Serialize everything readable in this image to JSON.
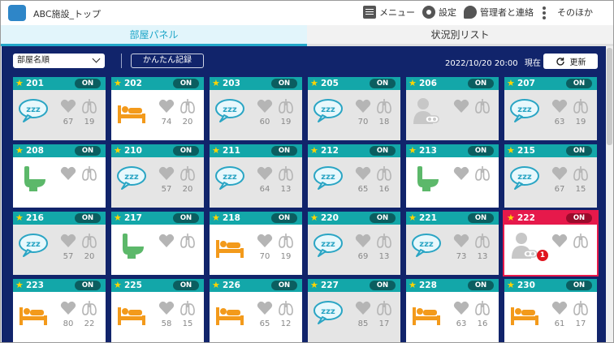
{
  "app": {
    "title": "ABC施設_トップ"
  },
  "header": {
    "menu_label": "メニュー",
    "settings_label": "設定",
    "contact_label": "管理者と連絡",
    "other_label": "そのほか"
  },
  "tabs": [
    {
      "label": "部屋パネル",
      "active": true
    },
    {
      "label": "状況別リスト",
      "active": false
    }
  ],
  "toolbar": {
    "sort_value": "部屋名順",
    "easy_record_label": "かんたん記録",
    "datetime": "2022/10/20 20:00",
    "current_label": "現在",
    "refresh_label": "更新"
  },
  "colors": {
    "board": "#11246b",
    "card_header": "#13a7a9",
    "alert": "#e6194b",
    "accent_orange": "#f39a1b",
    "accent_green": "#5cb86a",
    "accent_sleep": "#2aa5c4"
  },
  "rooms": [
    {
      "room": "201",
      "on": "ON",
      "status": "sleep",
      "hr": "67",
      "rr": "19"
    },
    {
      "room": "202",
      "on": "ON",
      "status": "bed",
      "hr": "74",
      "rr": "20"
    },
    {
      "room": "203",
      "on": "ON",
      "status": "sleep",
      "hr": "60",
      "rr": "19"
    },
    {
      "room": "205",
      "on": "ON",
      "status": "sleep",
      "hr": "70",
      "rr": "18"
    },
    {
      "room": "206",
      "on": "ON",
      "status": "away",
      "hr": "",
      "rr": ""
    },
    {
      "room": "207",
      "on": "ON",
      "status": "sleep",
      "hr": "63",
      "rr": "19"
    },
    {
      "room": "208",
      "on": "ON",
      "status": "toilet",
      "hr": "",
      "rr": ""
    },
    {
      "room": "210",
      "on": "ON",
      "status": "sleep",
      "hr": "57",
      "rr": "20"
    },
    {
      "room": "211",
      "on": "ON",
      "status": "sleep",
      "hr": "64",
      "rr": "13"
    },
    {
      "room": "212",
      "on": "ON",
      "status": "sleep",
      "hr": "65",
      "rr": "16"
    },
    {
      "room": "213",
      "on": "ON",
      "status": "toilet",
      "hr": "",
      "rr": ""
    },
    {
      "room": "215",
      "on": "ON",
      "status": "sleep",
      "hr": "67",
      "rr": "15"
    },
    {
      "room": "216",
      "on": "ON",
      "status": "sleep",
      "hr": "57",
      "rr": "20"
    },
    {
      "room": "217",
      "on": "ON",
      "status": "toilet",
      "hr": "",
      "rr": ""
    },
    {
      "room": "218",
      "on": "ON",
      "status": "bed",
      "hr": "70",
      "rr": "19"
    },
    {
      "room": "220",
      "on": "ON",
      "status": "sleep",
      "hr": "69",
      "rr": "13"
    },
    {
      "room": "221",
      "on": "ON",
      "status": "sleep",
      "hr": "73",
      "rr": "13"
    },
    {
      "room": "222",
      "on": "ON",
      "status": "away",
      "hr": "",
      "rr": "",
      "alert": true,
      "alert_count": "1"
    },
    {
      "room": "223",
      "on": "ON",
      "status": "bed",
      "hr": "80",
      "rr": "22"
    },
    {
      "room": "225",
      "on": "ON",
      "status": "bed",
      "hr": "58",
      "rr": "15"
    },
    {
      "room": "226",
      "on": "ON",
      "status": "bed",
      "hr": "65",
      "rr": "12"
    },
    {
      "room": "227",
      "on": "ON",
      "status": "sleep",
      "hr": "85",
      "rr": "17"
    },
    {
      "room": "228",
      "on": "ON",
      "status": "bed",
      "hr": "63",
      "rr": "16"
    },
    {
      "room": "230",
      "on": "ON",
      "status": "bed",
      "hr": "61",
      "rr": "17"
    }
  ]
}
